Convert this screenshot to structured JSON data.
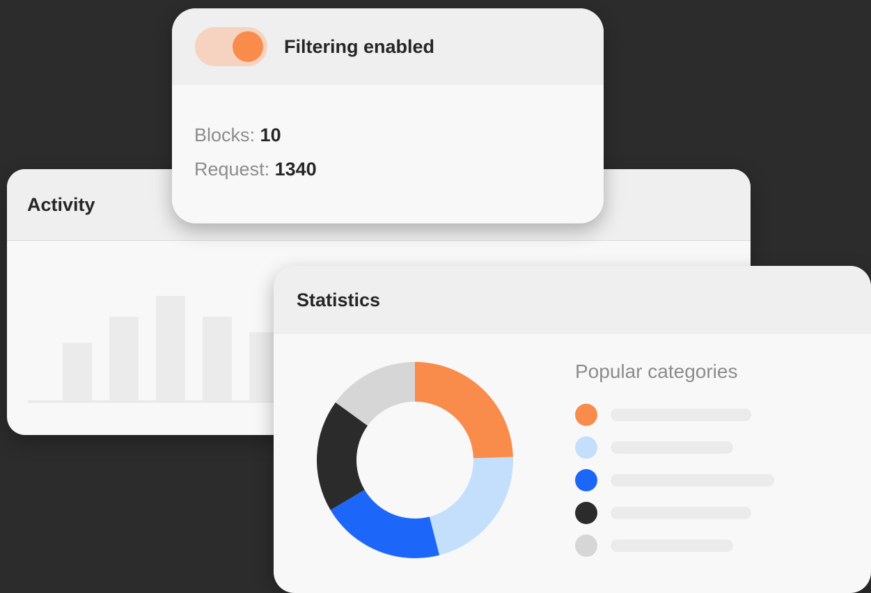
{
  "filter": {
    "toggle_on": true,
    "title": "Filtering enabled",
    "blocks_label": "Blocks:",
    "blocks_value": "10",
    "request_label": "Request:",
    "request_value": "1340"
  },
  "activity": {
    "title": "Activity",
    "bar_levels": [
      0.55,
      0.8,
      1.0,
      0.8,
      0.65
    ]
  },
  "statistics": {
    "title": "Statistics",
    "legend_title": "Popular categories"
  },
  "chart_data": {
    "type": "pie",
    "hole": true,
    "slices": [
      {
        "value": 24.5,
        "color": "#f98b4b"
      },
      {
        "value": 21.5,
        "color": "#c4dffb"
      },
      {
        "value": 20.5,
        "color": "#1c67fa"
      },
      {
        "value": 18.5,
        "color": "#2b2b2b"
      },
      {
        "value": 15.0,
        "color": "#d6d6d6"
      }
    ]
  },
  "colors": {
    "accent": "#f98b4b",
    "toggle_track": "#f5d3c0",
    "background": "#2c2c2c"
  }
}
